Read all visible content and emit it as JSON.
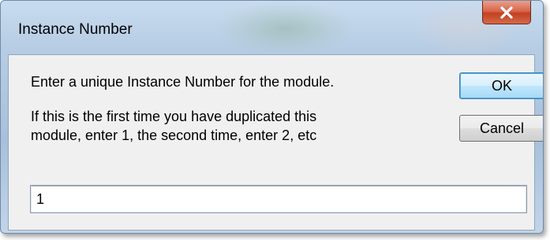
{
  "window": {
    "title": "Instance Number"
  },
  "titlebar": {
    "close_icon": "close-x-icon",
    "close_color": "#c7432a"
  },
  "dialog": {
    "prompt": "Enter a unique Instance Number for the module.",
    "hint_line1": "If this is the first time you have duplicated this",
    "hint_line2": "module, enter 1, the second time, enter 2, etc"
  },
  "buttons": {
    "ok_label": "OK",
    "cancel_label": "Cancel"
  },
  "instance_input": {
    "value": "1"
  }
}
